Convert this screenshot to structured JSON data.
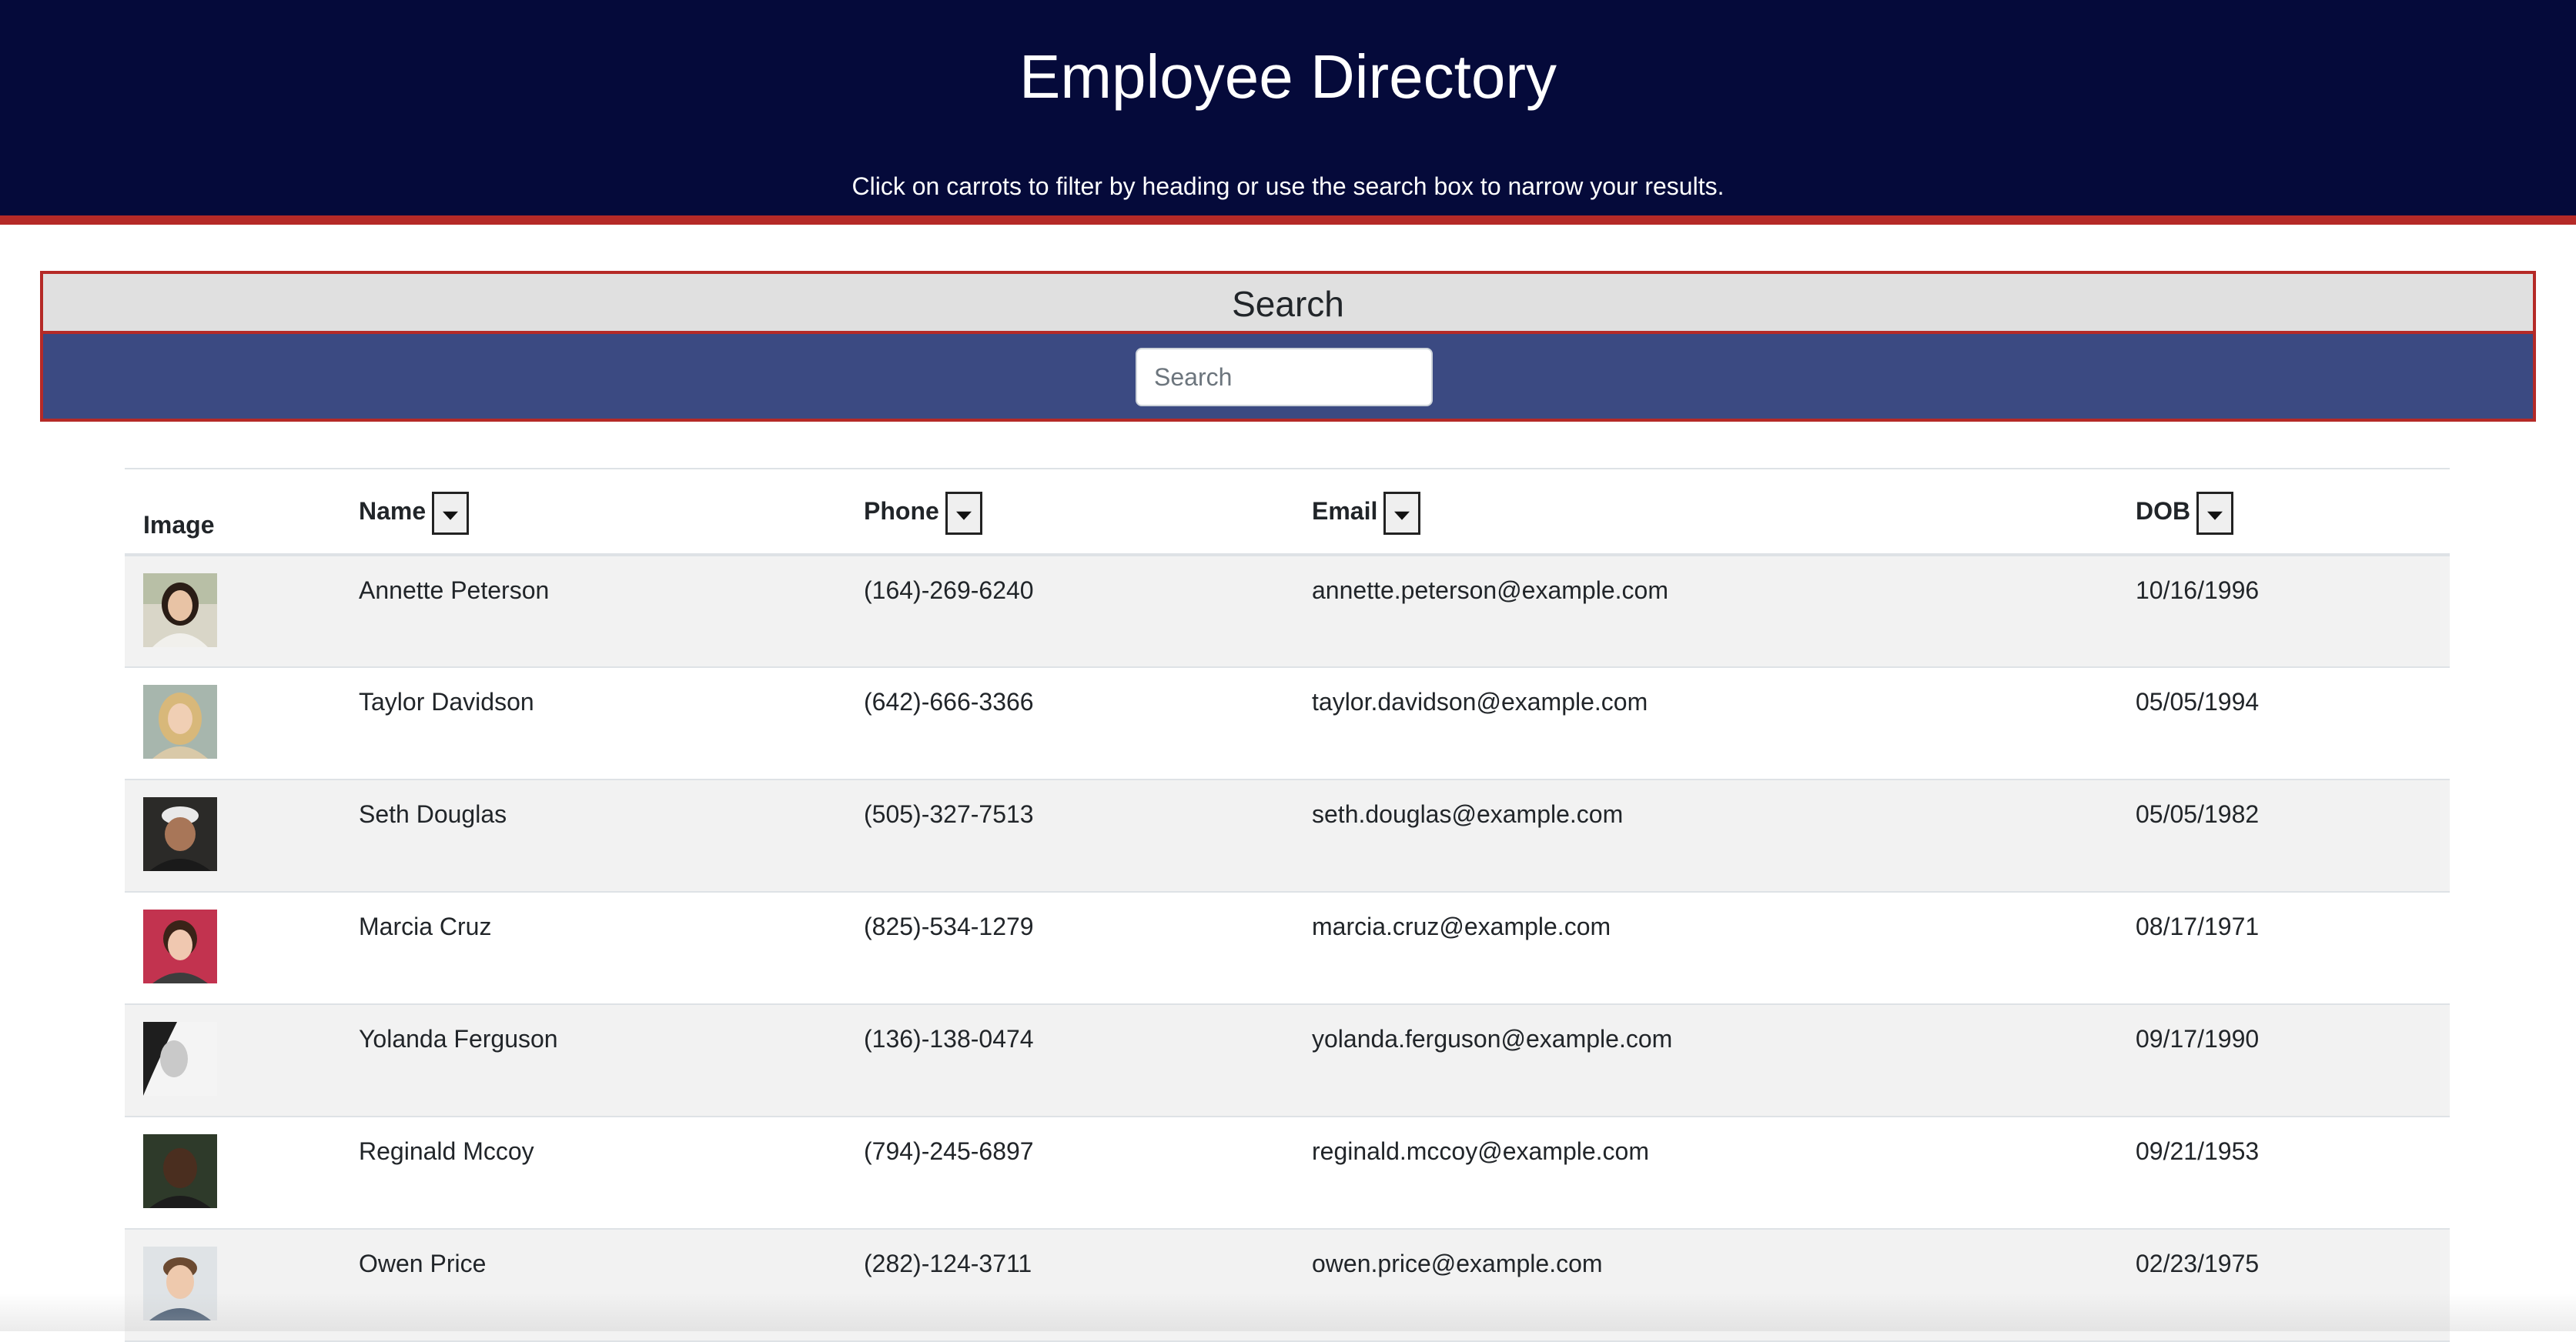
{
  "header": {
    "title": "Employee Directory",
    "subtitle": "Click on carrots to filter by heading or use the search box to narrow your results."
  },
  "search": {
    "heading": "Search",
    "placeholder": "Search",
    "value": ""
  },
  "table": {
    "columns": {
      "image": "Image",
      "name": "Name",
      "phone": "Phone",
      "email": "Email",
      "dob": "DOB"
    },
    "rows": [
      {
        "name": "Annette Peterson",
        "phone": "(164)-269-6240",
        "email": "annette.peterson@example.com",
        "dob": "10/16/1996"
      },
      {
        "name": "Taylor Davidson",
        "phone": "(642)-666-3366",
        "email": "taylor.davidson@example.com",
        "dob": "05/05/1994"
      },
      {
        "name": "Seth Douglas",
        "phone": "(505)-327-7513",
        "email": "seth.douglas@example.com",
        "dob": "05/05/1982"
      },
      {
        "name": "Marcia Cruz",
        "phone": "(825)-534-1279",
        "email": "marcia.cruz@example.com",
        "dob": "08/17/1971"
      },
      {
        "name": "Yolanda Ferguson",
        "phone": "(136)-138-0474",
        "email": "yolanda.ferguson@example.com",
        "dob": "09/17/1990"
      },
      {
        "name": "Reginald Mccoy",
        "phone": "(794)-245-6897",
        "email": "reginald.mccoy@example.com",
        "dob": "09/21/1953"
      },
      {
        "name": "Owen Price",
        "phone": "(282)-124-3711",
        "email": "owen.price@example.com",
        "dob": "02/23/1975"
      }
    ]
  },
  "colors": {
    "header_bg": "#050a3a",
    "accent_red": "#b52a27",
    "search_bar_bg": "#3b4a82",
    "search_heading_bg": "#e0e0e0",
    "row_stripe": "#f2f2f2"
  },
  "icons": {
    "sort": "caret-down-icon",
    "avatar": "employee-photo"
  }
}
